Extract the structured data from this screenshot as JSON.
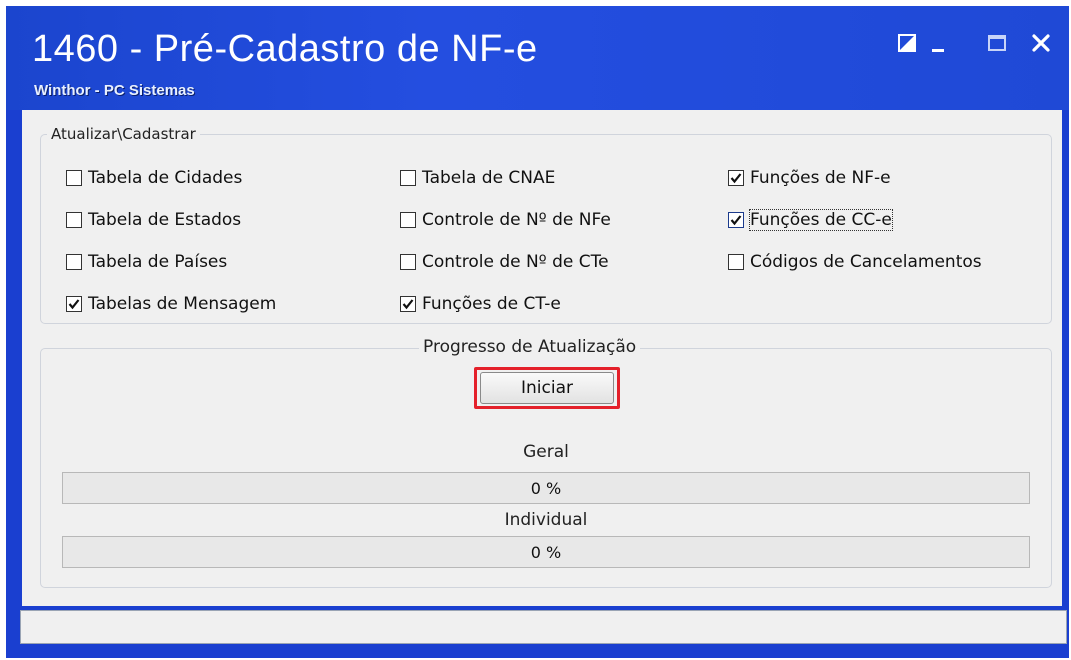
{
  "window": {
    "title": "1460 - Pré-Cadastro de NF-e",
    "subtitle": "Winthor - PC Sistemas"
  },
  "icons": {
    "restore": "restore-icon",
    "minimize": "minimize-icon",
    "maximize": "maximize-icon",
    "close": "close-icon"
  },
  "group_update": {
    "label": "Atualizar\\Cadastrar",
    "checkboxes": [
      {
        "label": "Tabela de Cidades",
        "checked": false
      },
      {
        "label": "Tabela de CNAE",
        "checked": false
      },
      {
        "label": "Funções de NF-e",
        "checked": true
      },
      {
        "label": "Tabela de Estados",
        "checked": false
      },
      {
        "label": "Controle de Nº de NFe",
        "checked": false
      },
      {
        "label": "Funções de CC-e",
        "checked": true
      },
      {
        "label": "Tabela de Países",
        "checked": false
      },
      {
        "label": "Controle de Nº de CTe",
        "checked": false
      },
      {
        "label": "Códigos de Cancelamentos",
        "checked": false
      },
      {
        "label": "Tabelas de Mensagem",
        "checked": true
      },
      {
        "label": "Funções de CT-e",
        "checked": true
      }
    ]
  },
  "group_progress": {
    "label": "Progresso de Atualização",
    "start_button": "Iniciar",
    "general_label": "Geral",
    "general_value": "0 %",
    "general_fraction": 0,
    "individual_label": "Individual",
    "individual_value": "0 %",
    "individual_fraction": 0
  },
  "colors": {
    "titlebar": "#1f49d6",
    "highlight": "#e4202a"
  }
}
